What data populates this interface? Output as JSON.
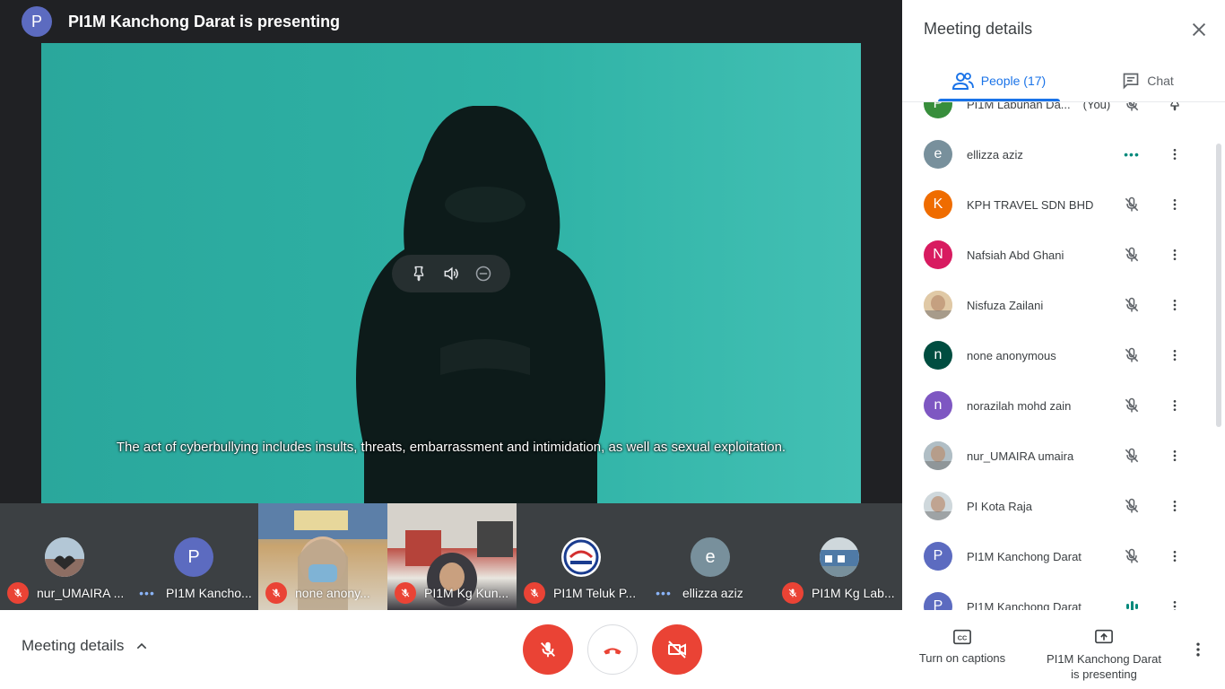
{
  "presenter": {
    "initial": "P",
    "text": "PI1M Kanchong Darat is presenting",
    "color": "#5c6bc0"
  },
  "video": {
    "subtitle": "The act of cyberbullying includes insults, threats, embarrassment and intimidation, as well as sexual exploitation."
  },
  "tile_controls": [
    "pin-icon",
    "volume-icon",
    "remove-icon"
  ],
  "filmstrip": [
    {
      "name": "nur_UMAIRA ...",
      "status": "muted",
      "avatar": "photo-hands"
    },
    {
      "name": "PI1M Kancho...",
      "status": "speaking",
      "initial": "P",
      "color": "#5c6bc0"
    },
    {
      "name": "none anony...",
      "status": "muted",
      "avatar": "video"
    },
    {
      "name": "PI1M Kg Kun...",
      "status": "muted",
      "avatar": "video"
    },
    {
      "name": "PI1M Teluk P...",
      "status": "muted",
      "avatar": "logo"
    },
    {
      "name": "ellizza aziz",
      "status": "speaking",
      "initial": "e",
      "color": "#78909c"
    },
    {
      "name": "PI1M Kg Lab...",
      "status": "muted",
      "avatar": "photo-building"
    }
  ],
  "bottombar": {
    "details_label": "Meeting details",
    "captions_label": "Turn on captions",
    "presenting_line1": "PI1M Kanchong Darat",
    "presenting_line2": "is presenting"
  },
  "panel": {
    "title": "Meeting details",
    "tab_people": "People (17)",
    "tab_chat": "Chat",
    "people": [
      {
        "name": "PI1M Labuhan Da...",
        "suffix": "(You)",
        "initial": "P",
        "color": "#388e3c",
        "status": "muted",
        "partial": true
      },
      {
        "name": "ellizza aziz",
        "initial": "e",
        "color": "#78909c",
        "status": "speaking"
      },
      {
        "name": "KPH TRAVEL SDN BHD",
        "initial": "K",
        "color": "#ef6c00",
        "status": "muted"
      },
      {
        "name": "Nafsiah Abd Ghani",
        "initial": "N",
        "color": "#d81b60",
        "status": "muted"
      },
      {
        "name": "Nisfuza Zailani",
        "initial": "",
        "color": "#e0c9a6",
        "status": "muted",
        "photo": true
      },
      {
        "name": "none anonymous",
        "initial": "n",
        "color": "#004d40",
        "status": "muted"
      },
      {
        "name": "norazilah mohd zain",
        "initial": "n",
        "color": "#7e57c2",
        "status": "muted"
      },
      {
        "name": "nur_UMAIRA umaira",
        "initial": "",
        "color": "#b0bec5",
        "status": "muted",
        "photo": true
      },
      {
        "name": "PI Kota Raja",
        "initial": "",
        "color": "#cfd8dc",
        "status": "muted",
        "photo": true
      },
      {
        "name": "PI1M Kanchong Darat",
        "initial": "P",
        "color": "#5c6bc0",
        "status": "muted"
      },
      {
        "name": "PI1M Kanchong Darat",
        "initial": "P",
        "color": "#5c6bc0",
        "status": "talking"
      }
    ]
  },
  "colors": {
    "accent": "#1a73e8",
    "danger": "#ea4335",
    "teal": "#00897b"
  }
}
